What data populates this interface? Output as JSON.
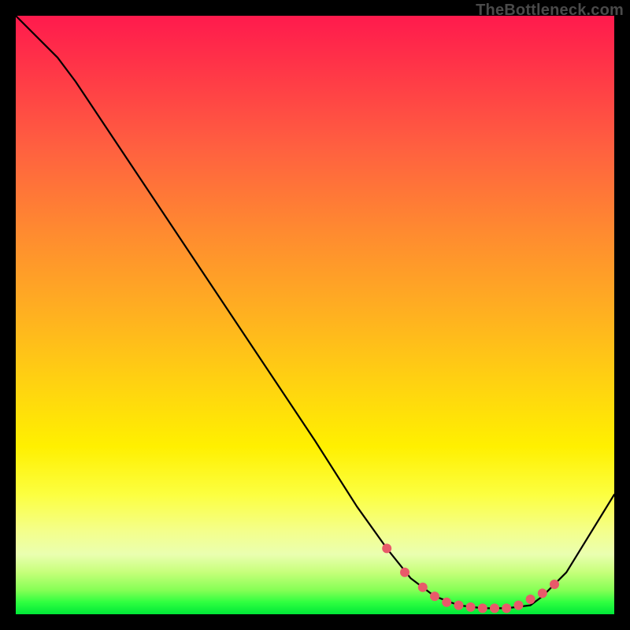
{
  "watermark": "TheBottleneck.com",
  "chart_data": {
    "type": "line",
    "title": "",
    "xlabel": "",
    "ylabel": "",
    "xlim": [
      0,
      100
    ],
    "ylim": [
      0,
      100
    ],
    "series": [
      {
        "name": "curve",
        "x": [
          0,
          7,
          10,
          20,
          30,
          40,
          50,
          57,
          62,
          66,
          70,
          74,
          78,
          82,
          86,
          88,
          92,
          100
        ],
        "values": [
          100,
          93,
          89,
          74,
          59,
          44,
          29,
          18,
          11,
          6,
          3,
          1.5,
          1,
          1,
          1.5,
          3,
          7,
          20
        ]
      }
    ],
    "markers": {
      "name": "highlight-dots",
      "color": "#e85a6a",
      "x": [
        62,
        65,
        68,
        70,
        72,
        74,
        76,
        78,
        80,
        82,
        84,
        86,
        88,
        90
      ],
      "values": [
        11,
        7,
        4.5,
        3,
        2,
        1.5,
        1.2,
        1,
        1,
        1,
        1.5,
        2.5,
        3.5,
        5
      ]
    }
  }
}
